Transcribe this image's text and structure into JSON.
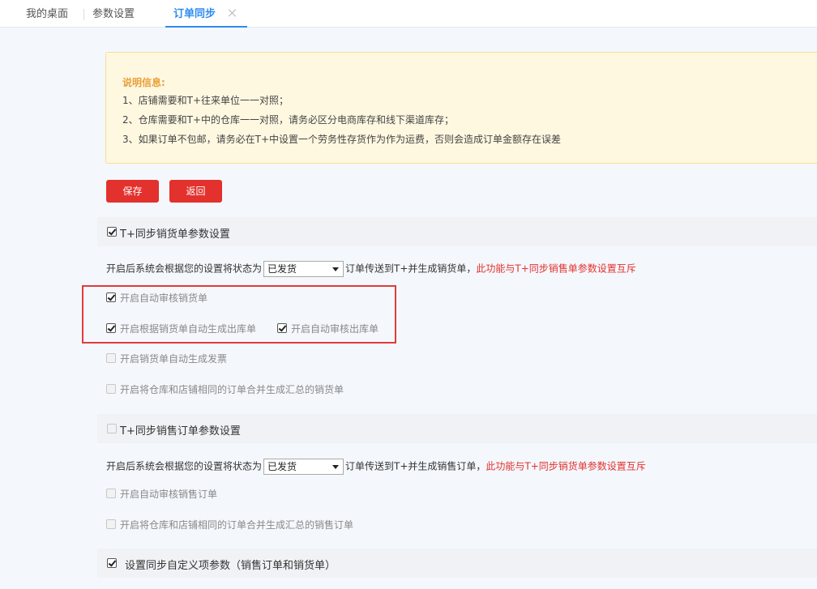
{
  "tabs": [
    {
      "label": "我的桌面"
    },
    {
      "label": "参数设置"
    },
    {
      "label": "订单同步"
    }
  ],
  "notice": {
    "title": "说明信息:",
    "lines": [
      "1、店铺需要和T+往来单位一一对照；",
      "2、仓库需要和T+中的仓库一一对照，请务必区分电商库存和线下渠道库存；",
      "3、如果订单不包邮，请务必在T+中设置一个劳务性存货作为作为运费，否则会造成订单金额存在误差"
    ]
  },
  "buttons": {
    "save": "保存",
    "back": "返回"
  },
  "sales_invoice": {
    "header": "T+同步销货单参数设置",
    "header_checked": true,
    "line_prefix": "开启后系统会根据您的设置将状态为",
    "status_value": "已发货",
    "line_suffix": "订单传送到T+并生成销货单，",
    "warning": "此功能与T+同步销售单参数设置互斥",
    "options": [
      {
        "label": "开启自动审核销货单",
        "checked": true
      },
      {
        "label": "开启根据销货单自动生成出库单",
        "checked": true
      },
      {
        "label": "开启自动审核出库单",
        "checked": true
      },
      {
        "label": "开启销货单自动生成发票",
        "checked": false
      },
      {
        "label": "开启将仓库和店铺相同的订单合并生成汇总的销货单",
        "checked": false
      }
    ]
  },
  "sales_order": {
    "header": "T+同步销售订单参数设置",
    "header_checked": false,
    "line_prefix": "开启后系统会根据您的设置将状态为",
    "status_value": "已发货",
    "line_suffix": "订单传送到T+并生成销售订单，",
    "warning": "此功能与T+同步销货单参数设置互斥",
    "options": [
      {
        "label": "开启自动审核销售订单",
        "checked": false
      },
      {
        "label": "开启将仓库和店铺相同的订单合并生成汇总的销售订单",
        "checked": false
      }
    ]
  },
  "custom_fields": {
    "header": "设置同步自定义项参数（销售订单和销货单）",
    "header_checked": true
  },
  "colors": {
    "accent": "#2d8cf0",
    "danger": "#e3312d",
    "notice_bg": "#fff8e1",
    "notice_title": "#e8a03a"
  }
}
